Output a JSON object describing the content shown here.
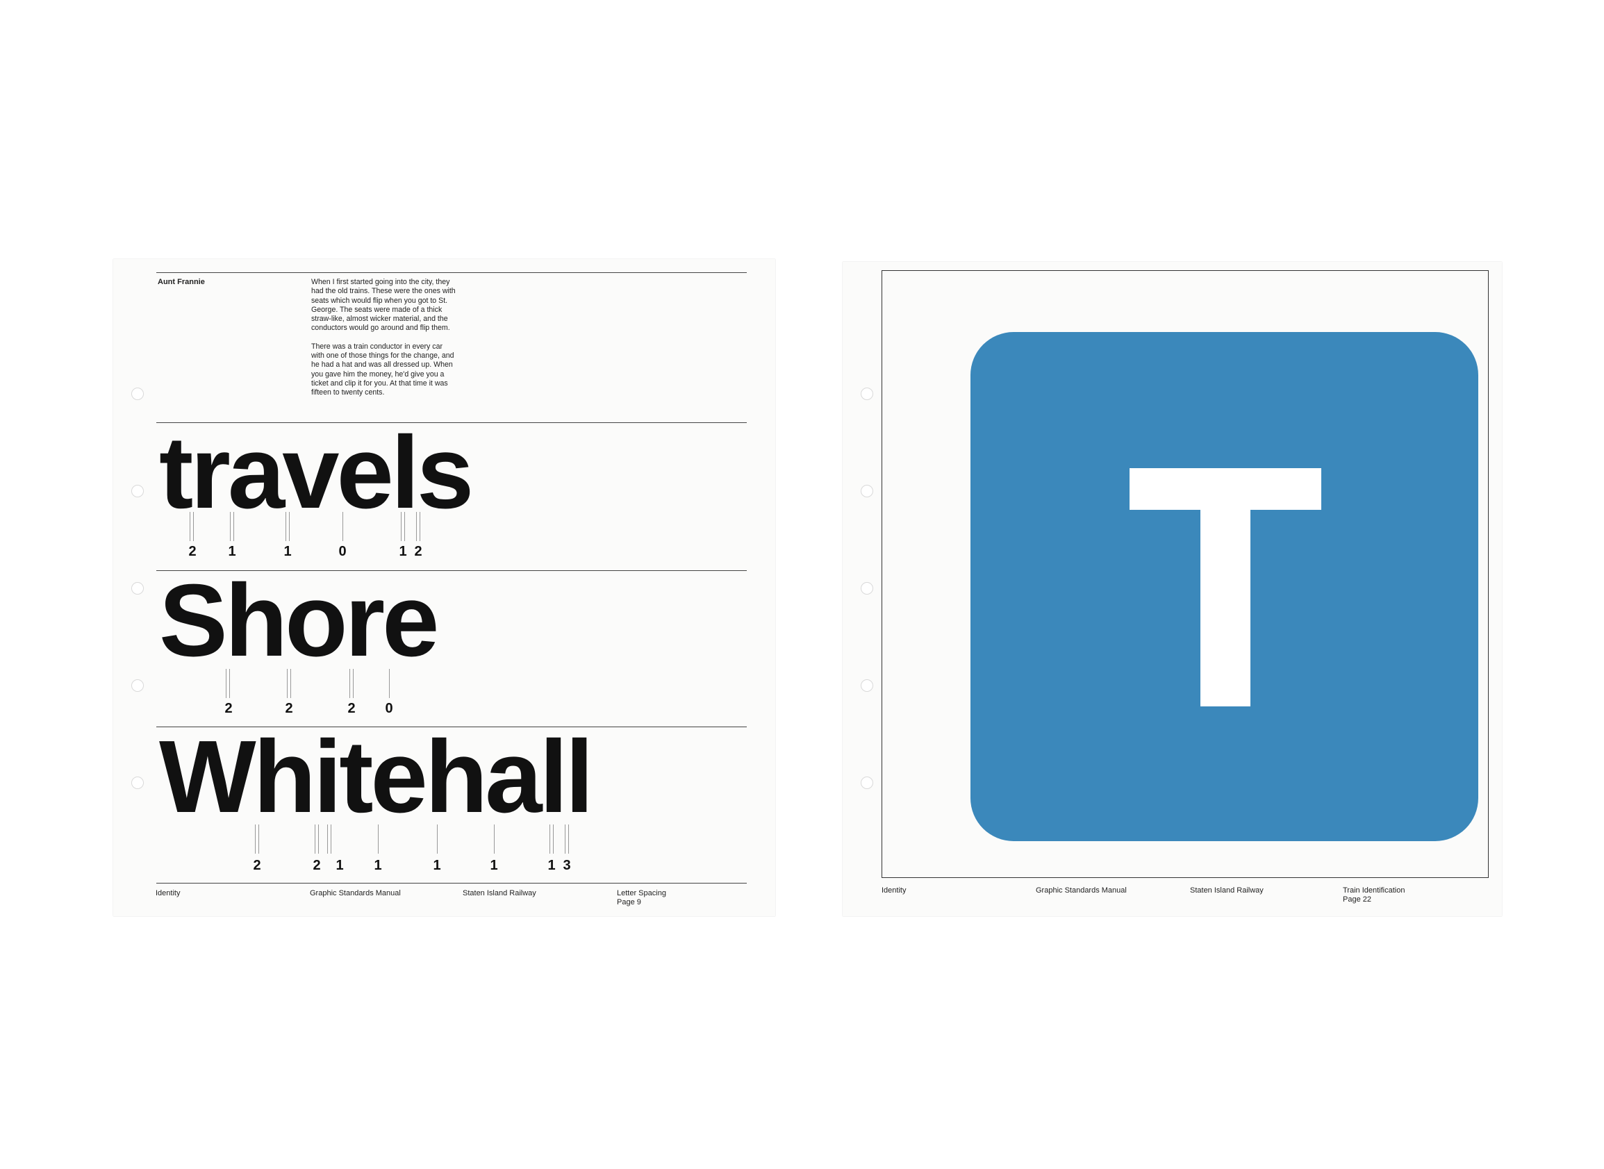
{
  "left_page": {
    "label": "Aunt Frannie",
    "paragraphs": [
      "When I first started going into the city, they had the old trains. These were the ones with  seats which would flip when you got to St. George. The seats were made of a thick straw-like, almost wicker material, and the conductors would go around and flip them.",
      "There was a train conductor in every car with one of those things for the change, and he had a hat and was all dressed up. When you gave him the money, he'd give you a ticket and clip it for you. At that time it was fifteen to twenty cents."
    ],
    "words": [
      {
        "text": "travels",
        "spacing": [
          "2",
          "1",
          "1",
          "0",
          "1",
          "2"
        ]
      },
      {
        "text": "Shore",
        "spacing": [
          "2",
          "2",
          "2",
          "0"
        ]
      },
      {
        "text": "Whitehall",
        "spacing": [
          "2",
          "2",
          "1",
          "1",
          "1",
          "1",
          "1",
          "3"
        ]
      }
    ],
    "footer": {
      "col1": "Identity",
      "col2": "Graphic Standards Manual",
      "col3": "Staten Island Railway",
      "col4_line1": "Letter Spacing",
      "col4_line2": "Page 9"
    }
  },
  "right_page": {
    "symbol_letter": "T",
    "colors": {
      "square": "#3b88bb",
      "letter": "#ffffff"
    },
    "footer": {
      "col1": "Identity",
      "col2": "Graphic Standards Manual",
      "col3": "Staten Island Railway",
      "col4_line1": "Train Identification",
      "col4_line2": "Page 22"
    }
  }
}
